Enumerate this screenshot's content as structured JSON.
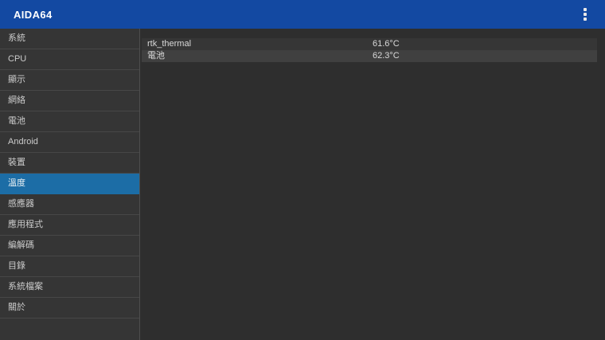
{
  "app_bar": {
    "title": "AIDA64"
  },
  "colors": {
    "app_bar_bg": "#1349a2",
    "selected_item_bg": "#1c6da6",
    "sidebar_bg": "#353535",
    "content_bg": "#2e2e2e",
    "row_odd_bg": "#363636",
    "row_even_bg": "#404040",
    "divider": "#474747",
    "panel_divider": "#4e4e4e",
    "sidebar_text": "#cbcbcb",
    "content_text": "#d9d9d9"
  },
  "sidebar": {
    "items": [
      {
        "label": "系統"
      },
      {
        "label": "CPU"
      },
      {
        "label": "顯示"
      },
      {
        "label": "網絡"
      },
      {
        "label": "電池"
      },
      {
        "label": "Android"
      },
      {
        "label": "裝置"
      },
      {
        "label": "溫度",
        "selected": true
      },
      {
        "label": "感應器"
      },
      {
        "label": "應用程式"
      },
      {
        "label": "編解碼"
      },
      {
        "label": "目錄"
      },
      {
        "label": "系統檔案"
      },
      {
        "label": "關於"
      }
    ]
  },
  "content": {
    "rows": [
      {
        "label": "rtk_thermal",
        "value": "61.6°C"
      },
      {
        "label": "電池",
        "value": "62.3°C"
      }
    ]
  }
}
